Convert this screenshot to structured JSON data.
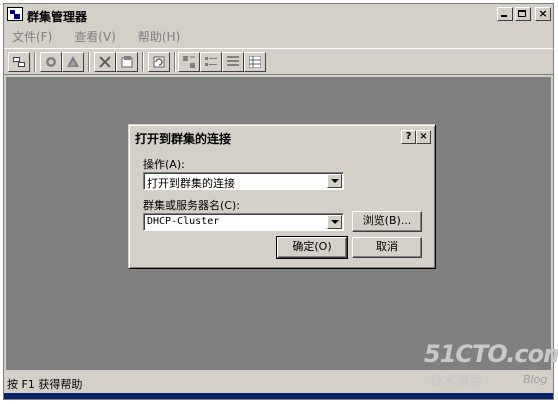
{
  "window": {
    "title": "群集管理器"
  },
  "menu": [
    {
      "label": "文件(F)"
    },
    {
      "label": "查看(V)"
    },
    {
      "label": "帮助(H)"
    }
  ],
  "toolbar": {
    "icons": [
      "open-connection-icon",
      "new-group-icon",
      "new-resource-icon",
      "delete-icon",
      "properties-icon",
      "refresh-icon",
      "large-icons-icon",
      "small-icons-icon",
      "list-icon",
      "details-icon"
    ]
  },
  "dialog": {
    "title": "打开到群集的连接",
    "help_glyph": "?",
    "close_glyph": "×",
    "action_label": "操作(A):",
    "action_value": "打开到群集的连接",
    "server_label": "群集或服务器名(C):",
    "server_value": "DHCP-Cluster",
    "browse_label": "浏览(B)...",
    "ok_label": "确定(O)",
    "cancel_label": "取消"
  },
  "status": {
    "text": "按 F1 获得帮助"
  },
  "watermark": {
    "site": "51CTO.com",
    "tagline": "技术博客",
    "blog": "Blog"
  }
}
